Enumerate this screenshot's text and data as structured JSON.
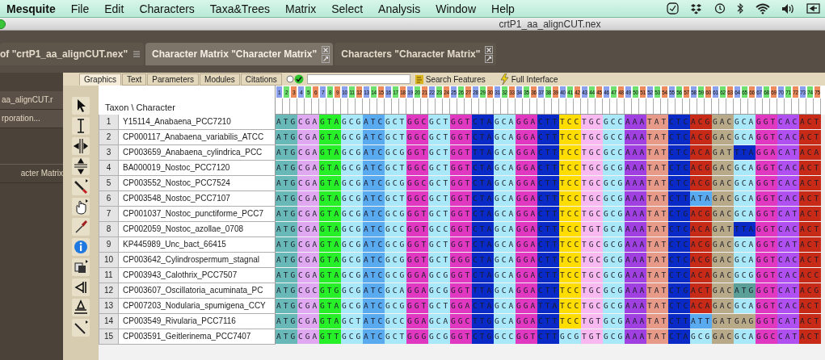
{
  "menu_bar": {
    "app": "Mesquite",
    "items": [
      "File",
      "Edit",
      "Characters",
      "Taxa&Trees",
      "Matrix",
      "Select",
      "Analysis",
      "Window",
      "Help"
    ]
  },
  "window": {
    "title": "crtP1_aa_alignCUT.nex"
  },
  "tabs": [
    {
      "label": "of \"crtP1_aa_alignCUT.nex\"",
      "selected": false
    },
    {
      "label": "Character Matrix \"Character Matrix\"",
      "selected": true
    },
    {
      "label": "Characters \"Character Matrix\"",
      "selected": false
    }
  ],
  "sidebar": {
    "items": [
      "aa_alignCUT.r",
      "rporation...",
      "acter Matrix"
    ]
  },
  "subtabs": [
    {
      "label": "Graphics",
      "selected": true
    },
    {
      "label": "Text",
      "selected": false
    },
    {
      "label": "Parameters",
      "selected": false
    },
    {
      "label": "Modules",
      "selected": false
    },
    {
      "label": "Citations",
      "selected": false
    }
  ],
  "search_features": "Search Features",
  "full_interface": "Full Interface",
  "matrix": {
    "corner": "Taxon \\ Character",
    "column_numbers": [
      "1",
      "2",
      "3",
      "4",
      "5",
      "6",
      "7",
      "8",
      "9",
      "10",
      "11",
      "12",
      "13",
      "14",
      "15",
      "16",
      "17",
      "18",
      "19",
      "20",
      "21",
      "22",
      "23",
      "24",
      "25",
      "26",
      "27",
      "28",
      "29",
      "30",
      "31",
      "32",
      "33",
      "34",
      "35",
      "36",
      "37",
      "38",
      "39",
      "40",
      "41",
      "42",
      "43",
      "44",
      "45",
      "46",
      "47",
      "48",
      "49",
      "50",
      "51",
      "52",
      "53",
      "54",
      "55",
      "56",
      "57",
      "58",
      "59",
      "60",
      "61",
      "62",
      "63",
      "64",
      "65",
      "66",
      "67",
      "68",
      "69",
      "70",
      "71",
      "72",
      "73",
      "74",
      "75"
    ],
    "rows": [
      {
        "number": "1",
        "taxon": "Y15114_Anabaena_PCC7210",
        "codons": [
          {
            "bases": "ATG",
            "color": "#68b8b8"
          },
          {
            "bases": "CGA",
            "color": "#e0a8f0"
          },
          {
            "bases": "GTA",
            "color": "#28f028"
          },
          {
            "bases": "GCG",
            "color": "#a8e8f8"
          },
          {
            "bases": "ATC",
            "color": "#5aaaf0"
          },
          {
            "bases": "GCT",
            "color": "#a8e8f8"
          },
          {
            "bases": "GGC",
            "color": "#e038c0"
          },
          {
            "bases": "GCT",
            "color": "#a8e8f8"
          },
          {
            "bases": "GGT",
            "color": "#e038c0"
          },
          {
            "bases": "CTA",
            "color": "#0a2ac8"
          },
          {
            "bases": "GCA",
            "color": "#a8e8f8"
          },
          {
            "bases": "GGA",
            "color": "#e038c0"
          },
          {
            "bases": "CTT",
            "color": "#0a2ac8"
          },
          {
            "bases": "TCC",
            "color": "#ffdd00"
          },
          {
            "bases": "TGC",
            "color": "#f8b8f0"
          },
          {
            "bases": "GCC",
            "color": "#a8e8f8"
          },
          {
            "bases": "AAA",
            "color": "#a040e0"
          },
          {
            "bases": "TAT",
            "color": "#e89a88"
          },
          {
            "bases": "CTC",
            "color": "#0a2ac8"
          },
          {
            "bases": "ACG",
            "color": "#c82a18"
          },
          {
            "bases": "GAC",
            "color": "#b8aa88"
          },
          {
            "bases": "GCA",
            "color": "#a8e8f8"
          },
          {
            "bases": "GGT",
            "color": "#e038c0"
          },
          {
            "bases": "CAC",
            "color": "#b050f0"
          },
          {
            "bases": "ACT",
            "color": "#c82a18"
          }
        ]
      },
      {
        "number": "2",
        "taxon": "CP000117_Anabaena_variabilis_ATCC",
        "codons": [
          {
            "bases": "ATG",
            "color": "#68b8b8"
          },
          {
            "bases": "CGA",
            "color": "#e0a8f0"
          },
          {
            "bases": "GTA",
            "color": "#28f028"
          },
          {
            "bases": "GCG",
            "color": "#a8e8f8"
          },
          {
            "bases": "ATC",
            "color": "#5aaaf0"
          },
          {
            "bases": "GCT",
            "color": "#a8e8f8"
          },
          {
            "bases": "GGC",
            "color": "#e038c0"
          },
          {
            "bases": "GCT",
            "color": "#a8e8f8"
          },
          {
            "bases": "GGT",
            "color": "#e038c0"
          },
          {
            "bases": "CTA",
            "color": "#0a2ac8"
          },
          {
            "bases": "GCA",
            "color": "#a8e8f8"
          },
          {
            "bases": "GGA",
            "color": "#e038c0"
          },
          {
            "bases": "CTT",
            "color": "#0a2ac8"
          },
          {
            "bases": "TCC",
            "color": "#ffdd00"
          },
          {
            "bases": "TGC",
            "color": "#f8b8f0"
          },
          {
            "bases": "GCC",
            "color": "#a8e8f8"
          },
          {
            "bases": "AAA",
            "color": "#a040e0"
          },
          {
            "bases": "TAT",
            "color": "#e89a88"
          },
          {
            "bases": "CTC",
            "color": "#0a2ac8"
          },
          {
            "bases": "ACG",
            "color": "#c82a18"
          },
          {
            "bases": "GAC",
            "color": "#b8aa88"
          },
          {
            "bases": "GCA",
            "color": "#a8e8f8"
          },
          {
            "bases": "GGT",
            "color": "#e038c0"
          },
          {
            "bases": "CAC",
            "color": "#b050f0"
          },
          {
            "bases": "ACT",
            "color": "#c82a18"
          }
        ]
      },
      {
        "number": "3",
        "taxon": "CP003659_Anabaena_cylindrica_PCC",
        "codons": [
          {
            "bases": "ATG",
            "color": "#68b8b8"
          },
          {
            "bases": "CGA",
            "color": "#e0a8f0"
          },
          {
            "bases": "GTA",
            "color": "#28f028"
          },
          {
            "bases": "GCG",
            "color": "#a8e8f8"
          },
          {
            "bases": "ATC",
            "color": "#5aaaf0"
          },
          {
            "bases": "GCG",
            "color": "#a8e8f8"
          },
          {
            "bases": "GGT",
            "color": "#e038c0"
          },
          {
            "bases": "GCT",
            "color": "#a8e8f8"
          },
          {
            "bases": "GGT",
            "color": "#e038c0"
          },
          {
            "bases": "TTA",
            "color": "#0a2ac8"
          },
          {
            "bases": "GCA",
            "color": "#a8e8f8"
          },
          {
            "bases": "GGA",
            "color": "#e038c0"
          },
          {
            "bases": "CTT",
            "color": "#0a2ac8"
          },
          {
            "bases": "TCC",
            "color": "#ffdd00"
          },
          {
            "bases": "TGC",
            "color": "#f8b8f0"
          },
          {
            "bases": "GCC",
            "color": "#a8e8f8"
          },
          {
            "bases": "AAA",
            "color": "#a040e0"
          },
          {
            "bases": "TAT",
            "color": "#e89a88"
          },
          {
            "bases": "CTC",
            "color": "#0a2ac8"
          },
          {
            "bases": "ACA",
            "color": "#c82a18"
          },
          {
            "bases": "GAT",
            "color": "#b8aa88"
          },
          {
            "bases": "TTA",
            "color": "#0a2ac8"
          },
          {
            "bases": "GGA",
            "color": "#e038c0"
          },
          {
            "bases": "CAT",
            "color": "#b050f0"
          },
          {
            "bases": "ACA",
            "color": "#c82a18"
          }
        ]
      },
      {
        "number": "4",
        "taxon": "BA000019_Nostoc_PCC7120",
        "codons": [
          {
            "bases": "ATG",
            "color": "#68b8b8"
          },
          {
            "bases": "CGA",
            "color": "#e0a8f0"
          },
          {
            "bases": "GTA",
            "color": "#28f028"
          },
          {
            "bases": "GCG",
            "color": "#a8e8f8"
          },
          {
            "bases": "ATC",
            "color": "#5aaaf0"
          },
          {
            "bases": "GCT",
            "color": "#a8e8f8"
          },
          {
            "bases": "GGC",
            "color": "#e038c0"
          },
          {
            "bases": "GCT",
            "color": "#a8e8f8"
          },
          {
            "bases": "GGT",
            "color": "#e038c0"
          },
          {
            "bases": "CTA",
            "color": "#0a2ac8"
          },
          {
            "bases": "GCA",
            "color": "#a8e8f8"
          },
          {
            "bases": "GGA",
            "color": "#e038c0"
          },
          {
            "bases": "CTT",
            "color": "#0a2ac8"
          },
          {
            "bases": "TCC",
            "color": "#ffdd00"
          },
          {
            "bases": "TGC",
            "color": "#f8b8f0"
          },
          {
            "bases": "GCG",
            "color": "#a8e8f8"
          },
          {
            "bases": "AAA",
            "color": "#a040e0"
          },
          {
            "bases": "TAT",
            "color": "#e89a88"
          },
          {
            "bases": "CTC",
            "color": "#0a2ac8"
          },
          {
            "bases": "ACG",
            "color": "#c82a18"
          },
          {
            "bases": "GAC",
            "color": "#b8aa88"
          },
          {
            "bases": "GCA",
            "color": "#a8e8f8"
          },
          {
            "bases": "GGT",
            "color": "#e038c0"
          },
          {
            "bases": "CAC",
            "color": "#b050f0"
          },
          {
            "bases": "ACT",
            "color": "#c82a18"
          }
        ]
      },
      {
        "number": "5",
        "taxon": "CP003552_Nostoc_PCC7524",
        "codons": [
          {
            "bases": "ATG",
            "color": "#68b8b8"
          },
          {
            "bases": "CGA",
            "color": "#e0a8f0"
          },
          {
            "bases": "GTA",
            "color": "#28f028"
          },
          {
            "bases": "GCG",
            "color": "#a8e8f8"
          },
          {
            "bases": "ATC",
            "color": "#5aaaf0"
          },
          {
            "bases": "GCG",
            "color": "#a8e8f8"
          },
          {
            "bases": "GGC",
            "color": "#e038c0"
          },
          {
            "bases": "GCT",
            "color": "#a8e8f8"
          },
          {
            "bases": "GGT",
            "color": "#e038c0"
          },
          {
            "bases": "CTA",
            "color": "#0a2ac8"
          },
          {
            "bases": "GCA",
            "color": "#a8e8f8"
          },
          {
            "bases": "GGA",
            "color": "#e038c0"
          },
          {
            "bases": "CTT",
            "color": "#0a2ac8"
          },
          {
            "bases": "TCC",
            "color": "#ffdd00"
          },
          {
            "bases": "TGC",
            "color": "#f8b8f0"
          },
          {
            "bases": "GCG",
            "color": "#a8e8f8"
          },
          {
            "bases": "AAA",
            "color": "#a040e0"
          },
          {
            "bases": "TAT",
            "color": "#e89a88"
          },
          {
            "bases": "CTC",
            "color": "#0a2ac8"
          },
          {
            "bases": "ACG",
            "color": "#c82a18"
          },
          {
            "bases": "GAC",
            "color": "#b8aa88"
          },
          {
            "bases": "GCA",
            "color": "#a8e8f8"
          },
          {
            "bases": "GGT",
            "color": "#e038c0"
          },
          {
            "bases": "CAC",
            "color": "#b050f0"
          },
          {
            "bases": "ACT",
            "color": "#c82a18"
          }
        ]
      },
      {
        "number": "6",
        "taxon": "CP003548_Nostoc_PCC7107",
        "codons": [
          {
            "bases": "ATG",
            "color": "#68b8b8"
          },
          {
            "bases": "CGA",
            "color": "#e0a8f0"
          },
          {
            "bases": "GTA",
            "color": "#28f028"
          },
          {
            "bases": "GCG",
            "color": "#a8e8f8"
          },
          {
            "bases": "ATC",
            "color": "#5aaaf0"
          },
          {
            "bases": "GCT",
            "color": "#a8e8f8"
          },
          {
            "bases": "GGC",
            "color": "#e038c0"
          },
          {
            "bases": "GCT",
            "color": "#a8e8f8"
          },
          {
            "bases": "GGT",
            "color": "#e038c0"
          },
          {
            "bases": "CTA",
            "color": "#0a2ac8"
          },
          {
            "bases": "GCA",
            "color": "#a8e8f8"
          },
          {
            "bases": "GGA",
            "color": "#e038c0"
          },
          {
            "bases": "CTT",
            "color": "#0a2ac8"
          },
          {
            "bases": "TCC",
            "color": "#ffdd00"
          },
          {
            "bases": "TGC",
            "color": "#f8b8f0"
          },
          {
            "bases": "GCG",
            "color": "#a8e8f8"
          },
          {
            "bases": "AAA",
            "color": "#a040e0"
          },
          {
            "bases": "TAT",
            "color": "#e89a88"
          },
          {
            "bases": "CTT",
            "color": "#0a2ac8"
          },
          {
            "bases": "ATA",
            "color": "#5aaaf0"
          },
          {
            "bases": "GAC",
            "color": "#b8aa88"
          },
          {
            "bases": "GCA",
            "color": "#a8e8f8"
          },
          {
            "bases": "GGT",
            "color": "#e038c0"
          },
          {
            "bases": "CAC",
            "color": "#b050f0"
          },
          {
            "bases": "ACT",
            "color": "#c82a18"
          }
        ]
      },
      {
        "number": "7",
        "taxon": "CP001037_Nostoc_punctiforme_PCC7",
        "codons": [
          {
            "bases": "ATG",
            "color": "#68b8b8"
          },
          {
            "bases": "CGA",
            "color": "#e0a8f0"
          },
          {
            "bases": "GTA",
            "color": "#28f028"
          },
          {
            "bases": "GCG",
            "color": "#a8e8f8"
          },
          {
            "bases": "ATC",
            "color": "#5aaaf0"
          },
          {
            "bases": "GCG",
            "color": "#a8e8f8"
          },
          {
            "bases": "GGT",
            "color": "#e038c0"
          },
          {
            "bases": "GCT",
            "color": "#a8e8f8"
          },
          {
            "bases": "GGT",
            "color": "#e038c0"
          },
          {
            "bases": "CTA",
            "color": "#0a2ac8"
          },
          {
            "bases": "GCA",
            "color": "#a8e8f8"
          },
          {
            "bases": "GGA",
            "color": "#e038c0"
          },
          {
            "bases": "CTT",
            "color": "#0a2ac8"
          },
          {
            "bases": "TCC",
            "color": "#ffdd00"
          },
          {
            "bases": "TGC",
            "color": "#f8b8f0"
          },
          {
            "bases": "GCG",
            "color": "#a8e8f8"
          },
          {
            "bases": "AAA",
            "color": "#a040e0"
          },
          {
            "bases": "TAT",
            "color": "#e89a88"
          },
          {
            "bases": "CTG",
            "color": "#0a2ac8"
          },
          {
            "bases": "ACG",
            "color": "#c82a18"
          },
          {
            "bases": "GAC",
            "color": "#b8aa88"
          },
          {
            "bases": "GCA",
            "color": "#a8e8f8"
          },
          {
            "bases": "GGT",
            "color": "#e038c0"
          },
          {
            "bases": "CAT",
            "color": "#b050f0"
          },
          {
            "bases": "ACT",
            "color": "#c82a18"
          }
        ]
      },
      {
        "number": "8",
        "taxon": "CP002059_Nostoc_azollae_0708",
        "codons": [
          {
            "bases": "ATG",
            "color": "#68b8b8"
          },
          {
            "bases": "CGA",
            "color": "#e0a8f0"
          },
          {
            "bases": "GTA",
            "color": "#28f028"
          },
          {
            "bases": "GCG",
            "color": "#a8e8f8"
          },
          {
            "bases": "ATC",
            "color": "#5aaaf0"
          },
          {
            "bases": "GCC",
            "color": "#a8e8f8"
          },
          {
            "bases": "GGT",
            "color": "#e038c0"
          },
          {
            "bases": "GCC",
            "color": "#a8e8f8"
          },
          {
            "bases": "GGT",
            "color": "#e038c0"
          },
          {
            "bases": "CTA",
            "color": "#0a2ac8"
          },
          {
            "bases": "GCA",
            "color": "#a8e8f8"
          },
          {
            "bases": "GGA",
            "color": "#e038c0"
          },
          {
            "bases": "CTT",
            "color": "#0a2ac8"
          },
          {
            "bases": "TCC",
            "color": "#ffdd00"
          },
          {
            "bases": "TGT",
            "color": "#f8b8f0"
          },
          {
            "bases": "GCA",
            "color": "#a8e8f8"
          },
          {
            "bases": "AAA",
            "color": "#a040e0"
          },
          {
            "bases": "TAT",
            "color": "#e89a88"
          },
          {
            "bases": "CTC",
            "color": "#0a2ac8"
          },
          {
            "bases": "ACA",
            "color": "#c82a18"
          },
          {
            "bases": "GAT",
            "color": "#b8aa88"
          },
          {
            "bases": "TTA",
            "color": "#0a2ac8"
          },
          {
            "bases": "GGT",
            "color": "#e038c0"
          },
          {
            "bases": "CAC",
            "color": "#b050f0"
          },
          {
            "bases": "ACT",
            "color": "#c82a18"
          }
        ]
      },
      {
        "number": "9",
        "taxon": "KP445989_Unc_bact_66415",
        "codons": [
          {
            "bases": "ATG",
            "color": "#68b8b8"
          },
          {
            "bases": "CGA",
            "color": "#e0a8f0"
          },
          {
            "bases": "GTA",
            "color": "#28f028"
          },
          {
            "bases": "GCG",
            "color": "#a8e8f8"
          },
          {
            "bases": "ATC",
            "color": "#5aaaf0"
          },
          {
            "bases": "GCG",
            "color": "#a8e8f8"
          },
          {
            "bases": "GGT",
            "color": "#e038c0"
          },
          {
            "bases": "GCT",
            "color": "#a8e8f8"
          },
          {
            "bases": "GGT",
            "color": "#e038c0"
          },
          {
            "bases": "CTA",
            "color": "#0a2ac8"
          },
          {
            "bases": "GCA",
            "color": "#a8e8f8"
          },
          {
            "bases": "GGA",
            "color": "#e038c0"
          },
          {
            "bases": "CTT",
            "color": "#0a2ac8"
          },
          {
            "bases": "TCC",
            "color": "#ffdd00"
          },
          {
            "bases": "TGC",
            "color": "#f8b8f0"
          },
          {
            "bases": "GCG",
            "color": "#a8e8f8"
          },
          {
            "bases": "AAA",
            "color": "#a040e0"
          },
          {
            "bases": "TAT",
            "color": "#e89a88"
          },
          {
            "bases": "CTC",
            "color": "#0a2ac8"
          },
          {
            "bases": "ACG",
            "color": "#c82a18"
          },
          {
            "bases": "GAC",
            "color": "#b8aa88"
          },
          {
            "bases": "GCA",
            "color": "#a8e8f8"
          },
          {
            "bases": "GGT",
            "color": "#e038c0"
          },
          {
            "bases": "CAT",
            "color": "#b050f0"
          },
          {
            "bases": "ACT",
            "color": "#c82a18"
          }
        ]
      },
      {
        "number": "10",
        "taxon": "CP003642_Cylindrospermum_stagnal",
        "codons": [
          {
            "bases": "ATG",
            "color": "#68b8b8"
          },
          {
            "bases": "CGA",
            "color": "#e0a8f0"
          },
          {
            "bases": "GTA",
            "color": "#28f028"
          },
          {
            "bases": "GCG",
            "color": "#a8e8f8"
          },
          {
            "bases": "ATC",
            "color": "#5aaaf0"
          },
          {
            "bases": "GCG",
            "color": "#a8e8f8"
          },
          {
            "bases": "GGT",
            "color": "#e038c0"
          },
          {
            "bases": "GCT",
            "color": "#a8e8f8"
          },
          {
            "bases": "GGG",
            "color": "#e038c0"
          },
          {
            "bases": "CTA",
            "color": "#0a2ac8"
          },
          {
            "bases": "GCA",
            "color": "#a8e8f8"
          },
          {
            "bases": "GGA",
            "color": "#e038c0"
          },
          {
            "bases": "CTT",
            "color": "#0a2ac8"
          },
          {
            "bases": "TCC",
            "color": "#ffdd00"
          },
          {
            "bases": "TGC",
            "color": "#f8b8f0"
          },
          {
            "bases": "GCG",
            "color": "#a8e8f8"
          },
          {
            "bases": "AAA",
            "color": "#a040e0"
          },
          {
            "bases": "TAT",
            "color": "#e89a88"
          },
          {
            "bases": "CTC",
            "color": "#0a2ac8"
          },
          {
            "bases": "ACG",
            "color": "#c82a18"
          },
          {
            "bases": "GAC",
            "color": "#b8aa88"
          },
          {
            "bases": "GCA",
            "color": "#a8e8f8"
          },
          {
            "bases": "GGT",
            "color": "#e038c0"
          },
          {
            "bases": "CAC",
            "color": "#b050f0"
          },
          {
            "bases": "ACT",
            "color": "#c82a18"
          }
        ]
      },
      {
        "number": "11",
        "taxon": "CP003943_Calothrix_PCC7507",
        "codons": [
          {
            "bases": "ATG",
            "color": "#68b8b8"
          },
          {
            "bases": "CGA",
            "color": "#e0a8f0"
          },
          {
            "bases": "GTA",
            "color": "#28f028"
          },
          {
            "bases": "GCG",
            "color": "#a8e8f8"
          },
          {
            "bases": "ATC",
            "color": "#5aaaf0"
          },
          {
            "bases": "GCG",
            "color": "#a8e8f8"
          },
          {
            "bases": "GGA",
            "color": "#e038c0"
          },
          {
            "bases": "GCG",
            "color": "#a8e8f8"
          },
          {
            "bases": "GGT",
            "color": "#e038c0"
          },
          {
            "bases": "CTA",
            "color": "#0a2ac8"
          },
          {
            "bases": "GCA",
            "color": "#a8e8f8"
          },
          {
            "bases": "GGA",
            "color": "#e038c0"
          },
          {
            "bases": "CTT",
            "color": "#0a2ac8"
          },
          {
            "bases": "TCC",
            "color": "#ffdd00"
          },
          {
            "bases": "TGC",
            "color": "#f8b8f0"
          },
          {
            "bases": "GCG",
            "color": "#a8e8f8"
          },
          {
            "bases": "AAA",
            "color": "#a040e0"
          },
          {
            "bases": "TAT",
            "color": "#e89a88"
          },
          {
            "bases": "CTC",
            "color": "#0a2ac8"
          },
          {
            "bases": "ACA",
            "color": "#c82a18"
          },
          {
            "bases": "GAC",
            "color": "#b8aa88"
          },
          {
            "bases": "GCG",
            "color": "#a8e8f8"
          },
          {
            "bases": "GGT",
            "color": "#e038c0"
          },
          {
            "bases": "CAC",
            "color": "#b050f0"
          },
          {
            "bases": "ACC",
            "color": "#c82a18"
          }
        ]
      },
      {
        "number": "12",
        "taxon": "CP003607_Oscillatoria_acuminata_PC",
        "codons": [
          {
            "bases": "ATG",
            "color": "#68b8b8"
          },
          {
            "bases": "CGC",
            "color": "#e0a8f0"
          },
          {
            "bases": "GTG",
            "color": "#28f028"
          },
          {
            "bases": "GCG",
            "color": "#a8e8f8"
          },
          {
            "bases": "ATC",
            "color": "#5aaaf0"
          },
          {
            "bases": "GCA",
            "color": "#a8e8f8"
          },
          {
            "bases": "GGA",
            "color": "#e038c0"
          },
          {
            "bases": "GCG",
            "color": "#a8e8f8"
          },
          {
            "bases": "GGT",
            "color": "#e038c0"
          },
          {
            "bases": "TTA",
            "color": "#0a2ac8"
          },
          {
            "bases": "GCA",
            "color": "#a8e8f8"
          },
          {
            "bases": "GGA",
            "color": "#e038c0"
          },
          {
            "bases": "CTT",
            "color": "#0a2ac8"
          },
          {
            "bases": "TCC",
            "color": "#ffdd00"
          },
          {
            "bases": "TGC",
            "color": "#f8b8f0"
          },
          {
            "bases": "GCG",
            "color": "#a8e8f8"
          },
          {
            "bases": "AAA",
            "color": "#a040e0"
          },
          {
            "bases": "TAT",
            "color": "#e89a88"
          },
          {
            "bases": "CTG",
            "color": "#0a2ac8"
          },
          {
            "bases": "ACT",
            "color": "#c82a18"
          },
          {
            "bases": "GAC",
            "color": "#b8aa88"
          },
          {
            "bases": "ATG",
            "color": "#5aa098"
          },
          {
            "bases": "GGT",
            "color": "#e038c0"
          },
          {
            "bases": "CAT",
            "color": "#b050f0"
          },
          {
            "bases": "ACG",
            "color": "#c82a18"
          }
        ]
      },
      {
        "number": "13",
        "taxon": "CP007203_Nodularia_spumigena_CCY",
        "codons": [
          {
            "bases": "ATG",
            "color": "#68b8b8"
          },
          {
            "bases": "CGA",
            "color": "#e0a8f0"
          },
          {
            "bases": "GTA",
            "color": "#28f028"
          },
          {
            "bases": "GCG",
            "color": "#a8e8f8"
          },
          {
            "bases": "ATC",
            "color": "#5aaaf0"
          },
          {
            "bases": "GCG",
            "color": "#a8e8f8"
          },
          {
            "bases": "GGT",
            "color": "#e038c0"
          },
          {
            "bases": "GCT",
            "color": "#a8e8f8"
          },
          {
            "bases": "GGA",
            "color": "#e038c0"
          },
          {
            "bases": "CTA",
            "color": "#0a2ac8"
          },
          {
            "bases": "GCA",
            "color": "#a8e8f8"
          },
          {
            "bases": "GGA",
            "color": "#e038c0"
          },
          {
            "bases": "TTA",
            "color": "#0a2ac8"
          },
          {
            "bases": "TCC",
            "color": "#ffdd00"
          },
          {
            "bases": "TGC",
            "color": "#f8b8f0"
          },
          {
            "bases": "GCG",
            "color": "#a8e8f8"
          },
          {
            "bases": "AAA",
            "color": "#a040e0"
          },
          {
            "bases": "TAT",
            "color": "#e89a88"
          },
          {
            "bases": "CTC",
            "color": "#0a2ac8"
          },
          {
            "bases": "ACA",
            "color": "#c82a18"
          },
          {
            "bases": "GAC",
            "color": "#b8aa88"
          },
          {
            "bases": "GCA",
            "color": "#a8e8f8"
          },
          {
            "bases": "GGT",
            "color": "#e038c0"
          },
          {
            "bases": "CAC",
            "color": "#b050f0"
          },
          {
            "bases": "ACT",
            "color": "#c82a18"
          }
        ]
      },
      {
        "number": "14",
        "taxon": "CP003549_Rivularia_PCC7116",
        "codons": [
          {
            "bases": "ATG",
            "color": "#68b8b8"
          },
          {
            "bases": "CGA",
            "color": "#e0a8f0"
          },
          {
            "bases": "GTA",
            "color": "#28f028"
          },
          {
            "bases": "GCT",
            "color": "#a8e8f8"
          },
          {
            "bases": "ATC",
            "color": "#5aaaf0"
          },
          {
            "bases": "GCC",
            "color": "#a8e8f8"
          },
          {
            "bases": "GGA",
            "color": "#e038c0"
          },
          {
            "bases": "GCA",
            "color": "#a8e8f8"
          },
          {
            "bases": "GGC",
            "color": "#e038c0"
          },
          {
            "bases": "TTG",
            "color": "#0a2ac8"
          },
          {
            "bases": "GCA",
            "color": "#a8e8f8"
          },
          {
            "bases": "GGA",
            "color": "#e038c0"
          },
          {
            "bases": "CTT",
            "color": "#0a2ac8"
          },
          {
            "bases": "TCC",
            "color": "#ffdd00"
          },
          {
            "bases": "TGT",
            "color": "#f8b8f0"
          },
          {
            "bases": "GCG",
            "color": "#a8e8f8"
          },
          {
            "bases": "AAA",
            "color": "#a040e0"
          },
          {
            "bases": "TAT",
            "color": "#e89a88"
          },
          {
            "bases": "CTT",
            "color": "#0a2ac8"
          },
          {
            "bases": "ATT",
            "color": "#5aaaf0"
          },
          {
            "bases": "GAT",
            "color": "#b8aa88"
          },
          {
            "bases": "GAG",
            "color": "#b8aa88"
          },
          {
            "bases": "GGT",
            "color": "#e038c0"
          },
          {
            "bases": "CAT",
            "color": "#b050f0"
          },
          {
            "bases": "ACT",
            "color": "#c82a18"
          }
        ]
      },
      {
        "number": "15",
        "taxon": "CP003591_Geitlerinema_PCC7407",
        "codons": [
          {
            "bases": "ATG",
            "color": "#68b8b8"
          },
          {
            "bases": "CGA",
            "color": "#e0a8f0"
          },
          {
            "bases": "GTT",
            "color": "#28f028"
          },
          {
            "bases": "GCG",
            "color": "#a8e8f8"
          },
          {
            "bases": "ATC",
            "color": "#5aaaf0"
          },
          {
            "bases": "GCT",
            "color": "#a8e8f8"
          },
          {
            "bases": "GGG",
            "color": "#e038c0"
          },
          {
            "bases": "GCG",
            "color": "#a8e8f8"
          },
          {
            "bases": "GGT",
            "color": "#e038c0"
          },
          {
            "bases": "CTG",
            "color": "#0a2ac8"
          },
          {
            "bases": "GCC",
            "color": "#a8e8f8"
          },
          {
            "bases": "GGT",
            "color": "#e038c0"
          },
          {
            "bases": "CTT",
            "color": "#0a2ac8"
          },
          {
            "bases": "GCG",
            "color": "#a8e8f8"
          },
          {
            "bases": "TGT",
            "color": "#f8b8f0"
          },
          {
            "bases": "GCG",
            "color": "#a8e8f8"
          },
          {
            "bases": "AAA",
            "color": "#a040e0"
          },
          {
            "bases": "TAT",
            "color": "#e89a88"
          },
          {
            "bases": "CTA",
            "color": "#0a2ac8"
          },
          {
            "bases": "GCG",
            "color": "#a8e8f8"
          },
          {
            "bases": "GAC",
            "color": "#b8aa88"
          },
          {
            "bases": "GCA",
            "color": "#a8e8f8"
          },
          {
            "bases": "GGC",
            "color": "#e038c0"
          },
          {
            "bases": "CAT",
            "color": "#b050f0"
          },
          {
            "bases": "ACT",
            "color": "#c82a18"
          }
        ]
      }
    ]
  }
}
